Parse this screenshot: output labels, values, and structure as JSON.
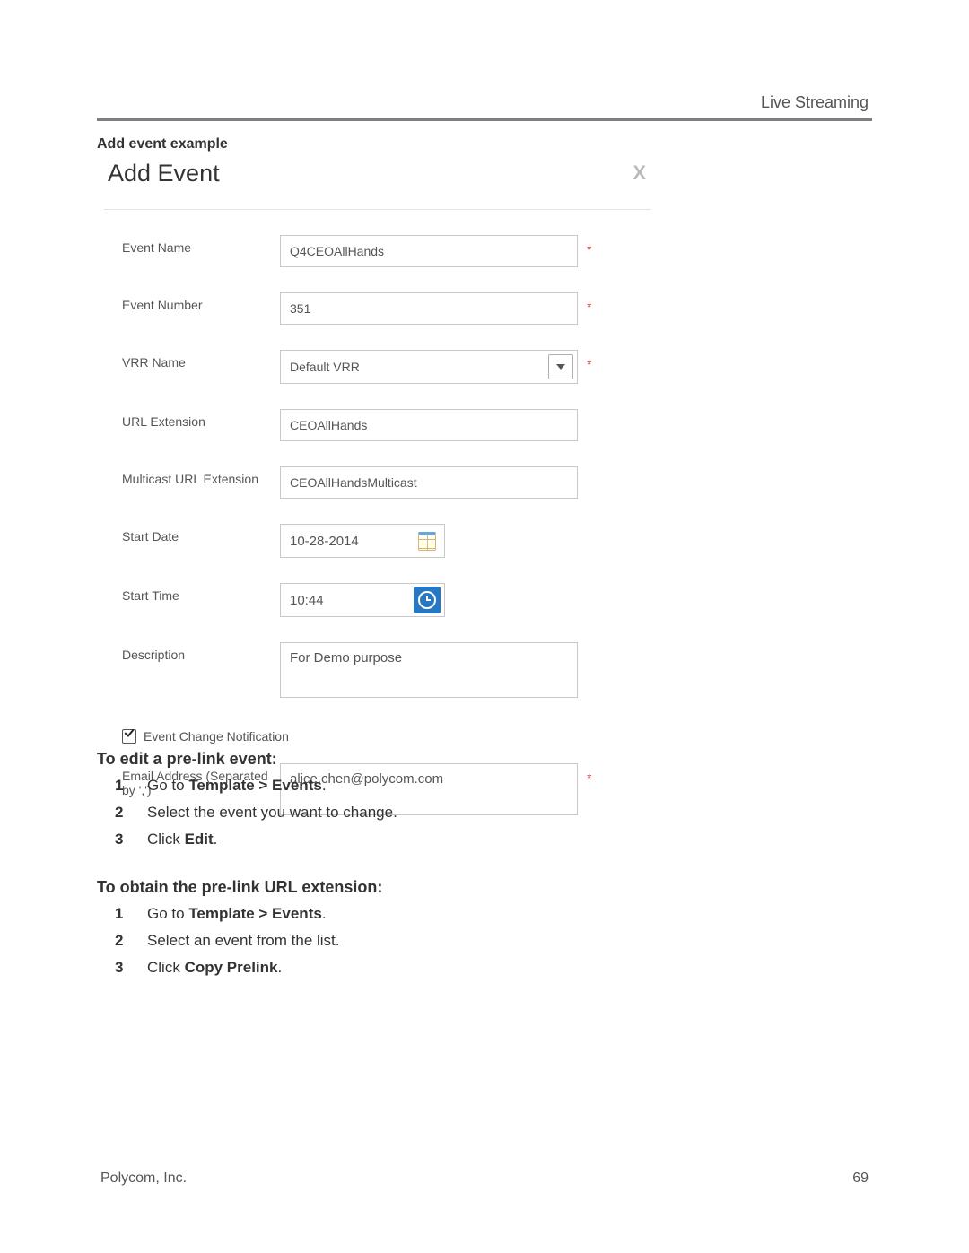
{
  "header": {
    "section": "Live Streaming"
  },
  "caption": "Add event example",
  "dialog": {
    "title": "Add Event",
    "fields": {
      "eventName": {
        "label": "Event Name",
        "value": "Q4CEOAllHands",
        "required": true
      },
      "eventNumber": {
        "label": "Event Number",
        "value": "351",
        "required": true
      },
      "vrrName": {
        "label": "VRR Name",
        "value": "Default VRR",
        "required": true
      },
      "urlExtension": {
        "label": "URL Extension",
        "value": "CEOAllHands",
        "required": false
      },
      "mcUrlExtension": {
        "label": "Multicast URL Extension",
        "value": "CEOAllHandsMulticast",
        "required": false
      },
      "startDate": {
        "label": "Start Date",
        "value": "10-28-2014",
        "required": false
      },
      "startTime": {
        "label": "Start Time",
        "value": "10:44",
        "required": false
      },
      "description": {
        "label": "Description",
        "value": "For Demo purpose",
        "required": false
      },
      "notifyCheckbox": {
        "label": "Event Change Notification",
        "checked": true
      },
      "emailAddress": {
        "label": "Email Address (Separated by ',')",
        "value": "alice.chen@polycom.com",
        "required": true
      }
    }
  },
  "sections": {
    "edit": {
      "heading": "To edit a pre-link event:",
      "steps": [
        {
          "prefix": "Go to ",
          "bold": "Template > Events",
          "suffix": "."
        },
        {
          "prefix": "Select the event you want to change.",
          "bold": "",
          "suffix": ""
        },
        {
          "prefix": "Click ",
          "bold": "Edit",
          "suffix": "."
        }
      ]
    },
    "obtain": {
      "heading": "To obtain the pre-link URL extension:",
      "steps": [
        {
          "prefix": "Go to ",
          "bold": "Template > Events",
          "suffix": "."
        },
        {
          "prefix": "Select an event from the list.",
          "bold": "",
          "suffix": ""
        },
        {
          "prefix": "Click ",
          "bold": "Copy Prelink",
          "suffix": "."
        }
      ]
    }
  },
  "footer": {
    "left": "Polycom, Inc.",
    "right": "69"
  }
}
